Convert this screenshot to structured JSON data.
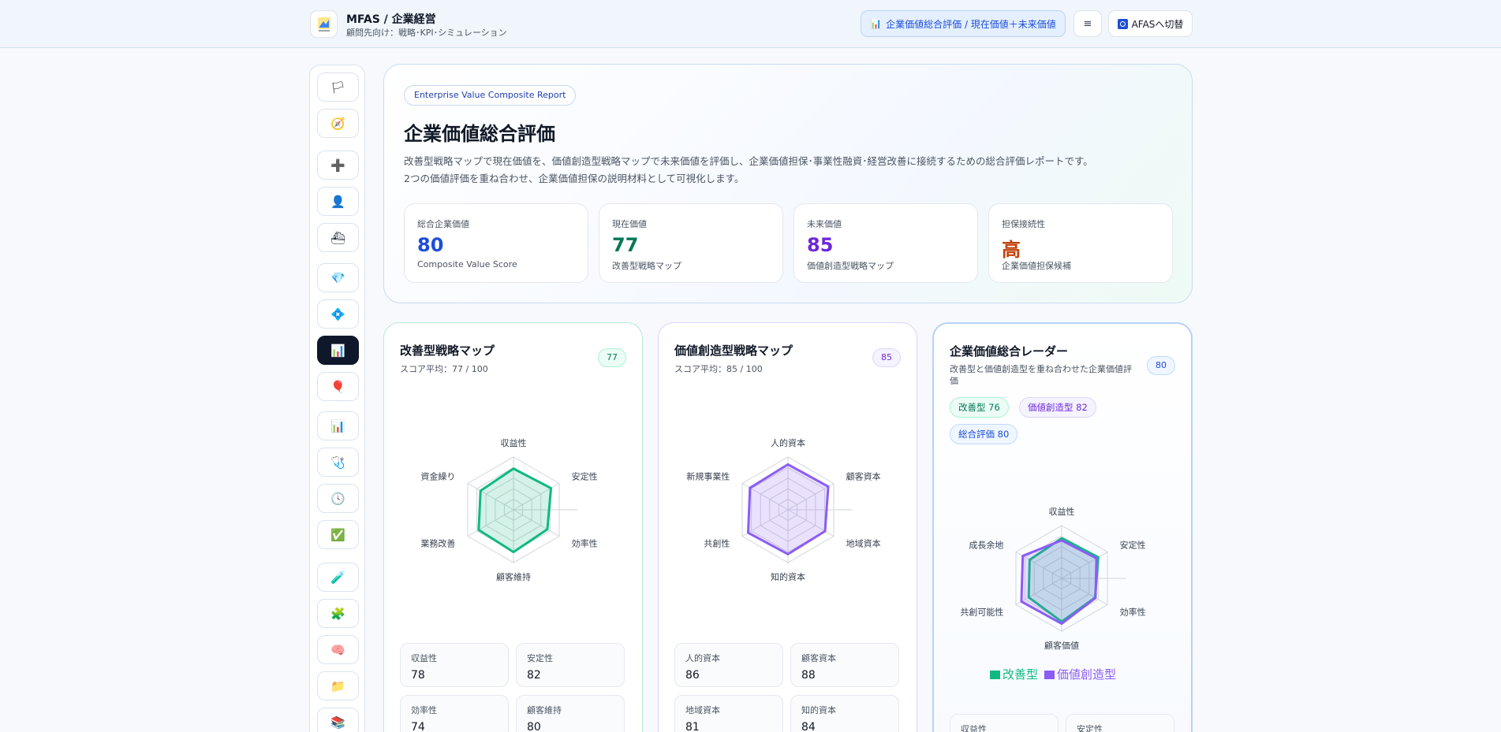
{
  "header": {
    "brand_title": "MFAS / 企業経営",
    "brand_subtitle": "顧問先向け：戦略･KPI･シミュレーション",
    "active_button": "企業価値総合評価 / 現在価値＋未来価値",
    "menu_button": "≡",
    "switch_button": "AFASへ切替"
  },
  "sidebar": {
    "items": [
      {
        "icon": "flag-icon",
        "glyph": "🏳"
      },
      {
        "icon": "compass-icon",
        "glyph": "🧭"
      },
      {
        "icon": "plus-icon",
        "glyph": "➕"
      },
      {
        "icon": "person-icon",
        "glyph": "👤"
      },
      {
        "icon": "stamp-icon",
        "glyph": "⛴"
      },
      {
        "icon": "gem-icon",
        "glyph": "💎"
      },
      {
        "icon": "diamond-icon",
        "glyph": "💠"
      },
      {
        "icon": "bar-chart-icon",
        "glyph": "📊",
        "active": true
      },
      {
        "icon": "balloon-icon",
        "glyph": "🎈"
      },
      {
        "icon": "chart-icon",
        "glyph": "📊"
      },
      {
        "icon": "stethoscope-icon",
        "glyph": "🩺"
      },
      {
        "icon": "clock-icon",
        "glyph": "🕓"
      },
      {
        "icon": "check-icon",
        "glyph": "✅"
      },
      {
        "icon": "test-tube-icon",
        "glyph": "🧪"
      },
      {
        "icon": "puzzle-icon",
        "glyph": "🧩"
      },
      {
        "icon": "brain-icon",
        "glyph": "🧠"
      },
      {
        "icon": "folder-icon",
        "glyph": "📁"
      },
      {
        "icon": "book-icon",
        "glyph": "📚"
      }
    ]
  },
  "hero": {
    "badge": "Enterprise Value Composite Report",
    "title": "企業価値総合評価",
    "desc_line1": "改善型戦略マップで現在価値を、価値創造型戦略マップで未来価値を評価し、企業価値担保･事業性融資･経営改善に接続するための総合評価レポートです。",
    "desc_line2": "2つの価値評価を重ね合わせ、企業価値担保の説明材料として可視化します。",
    "kpis": [
      {
        "label": "総合企業価値",
        "value": "80",
        "sub": "Composite Value Score",
        "color": "#1d4ed8"
      },
      {
        "label": "現在価値",
        "value": "77",
        "sub": "改善型戦略マップ",
        "color": "#047857"
      },
      {
        "label": "未来価値",
        "value": "85",
        "sub": "価値創造型戦略マップ",
        "color": "#6d28d9"
      },
      {
        "label": "担保接続性",
        "value": "高",
        "sub": "企業価値担保候補",
        "color": "#c2410c"
      }
    ]
  },
  "card1": {
    "title": "改善型戦略マップ",
    "subtitle": "スコア平均：77 / 100",
    "score": "77",
    "metrics": [
      {
        "label": "収益性",
        "value": "78"
      },
      {
        "label": "安定性",
        "value": "82"
      },
      {
        "label": "効率性",
        "value": "74"
      },
      {
        "label": "顧客維持",
        "value": "80"
      }
    ]
  },
  "card2": {
    "title": "価値創造型戦略マップ",
    "subtitle": "スコア平均：85 / 100",
    "score": "85",
    "metrics": [
      {
        "label": "人的資本",
        "value": "86"
      },
      {
        "label": "顧客資本",
        "value": "88"
      },
      {
        "label": "地域資本",
        "value": "81"
      },
      {
        "label": "知的資本",
        "value": "84"
      }
    ]
  },
  "card3": {
    "title": "企業価値総合レーダー",
    "subtitle": "改善型と価値創造型を重ね合わせた企業価値評価",
    "score": "80",
    "pills": [
      "改善型 76",
      "価値創造型 82",
      "総合評価 80"
    ],
    "legend": [
      "改善型",
      "価値創造型"
    ],
    "metrics": [
      {
        "label": "収益性"
      },
      {
        "label": "安定性"
      }
    ]
  },
  "chart_data": [
    {
      "type": "radar",
      "title": "改善型戦略マップ",
      "categories": [
        "収益性",
        "安定性",
        "効率性",
        "顧客維持",
        "業務改善",
        "資金繰り"
      ],
      "series": [
        {
          "values": [
            78,
            82,
            74,
            80,
            76,
            72
          ],
          "color": "#10b981"
        }
      ],
      "ylim": [
        0,
        100
      ]
    },
    {
      "type": "radar",
      "title": "価値創造型戦略マップ",
      "categories": [
        "人的資本",
        "顧客資本",
        "地域資本",
        "知的資本",
        "共創性",
        "新規事業性"
      ],
      "series": [
        {
          "values": [
            86,
            88,
            81,
            84,
            87,
            83
          ],
          "color": "#8b5cf6"
        }
      ],
      "ylim": [
        0,
        100
      ]
    },
    {
      "type": "radar",
      "title": "企業価値総合レーダー",
      "categories": [
        "収益性",
        "安定性",
        "効率性",
        "顧客価値",
        "共創可能性",
        "成長余地"
      ],
      "series": [
        {
          "name": "改善型",
          "values": [
            76,
            80,
            73,
            82,
            72,
            70
          ],
          "color": "#10b981"
        },
        {
          "name": "価値創造型",
          "values": [
            72,
            76,
            74,
            86,
            88,
            85
          ],
          "color": "#8b5cf6"
        }
      ],
      "ylim": [
        0,
        100
      ]
    }
  ]
}
